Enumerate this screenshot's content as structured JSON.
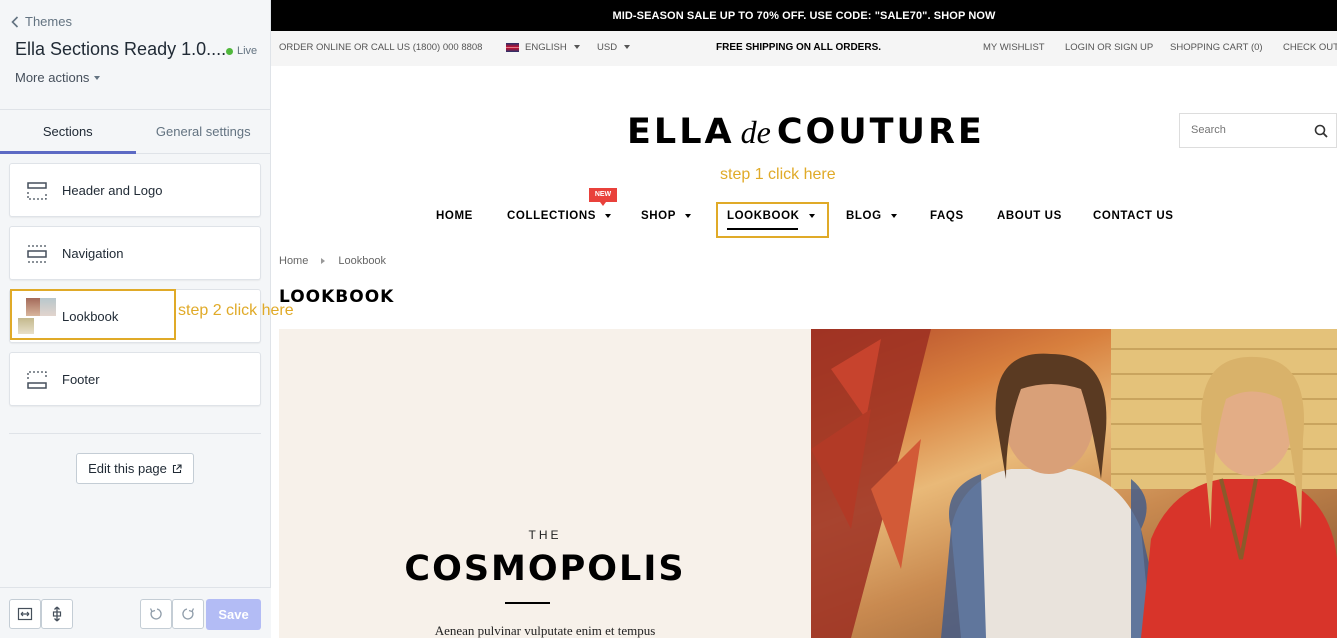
{
  "sidebar": {
    "back_label": "Themes",
    "theme_name": "Ella Sections Ready 1.0....",
    "live_label": "Live",
    "more_actions": "More actions",
    "tabs": [
      "Sections",
      "General settings"
    ],
    "sections": [
      {
        "label": "Header and Logo",
        "icon": "header-section-icon"
      },
      {
        "label": "Navigation",
        "icon": "navigation-section-icon"
      },
      {
        "label": "Lookbook",
        "icon": "lookbook-thumbnail"
      },
      {
        "label": "Footer",
        "icon": "footer-section-icon"
      }
    ],
    "edit_page": "Edit this page",
    "save": "Save"
  },
  "annotations": {
    "step1": "step 1 click here",
    "step2": "step 2 click here",
    "color": "#e0aa28"
  },
  "preview": {
    "promo": "MID-SEASON SALE UP TO 70% OFF. USE CODE: \"SALE70\". SHOP NOW",
    "util_left": "ORDER ONLINE OR CALL US (1800) 000 8808",
    "language": "ENGLISH",
    "currency": "USD",
    "free_shipping": "FREE SHIPPING ON ALL ORDERS.",
    "util_right": [
      "MY WISHLIST",
      "LOGIN OR SIGN UP",
      "SHOPPING CART (0)",
      "CHECK OUT"
    ],
    "logo": {
      "part1": "ELLA",
      "part2": "de",
      "part3": "COUTURE"
    },
    "search_placeholder": "Search",
    "nav": [
      "HOME",
      "COLLECTIONS",
      "SHOP",
      "LOOKBOOK",
      "BLOG",
      "FAQS",
      "ABOUT US",
      "CONTACT US"
    ],
    "new_badge": "NEW",
    "breadcrumb": [
      "Home",
      "Lookbook"
    ],
    "page_title": "LOOKBOOK",
    "banner": {
      "pre": "THE",
      "title": "COSMOPOLIS",
      "text": "Aenean pulvinar vulputate enim et tempus"
    }
  },
  "colors": {
    "accent": "#5c6ac4",
    "live": "#50b83c",
    "badge": "#e9413b"
  }
}
